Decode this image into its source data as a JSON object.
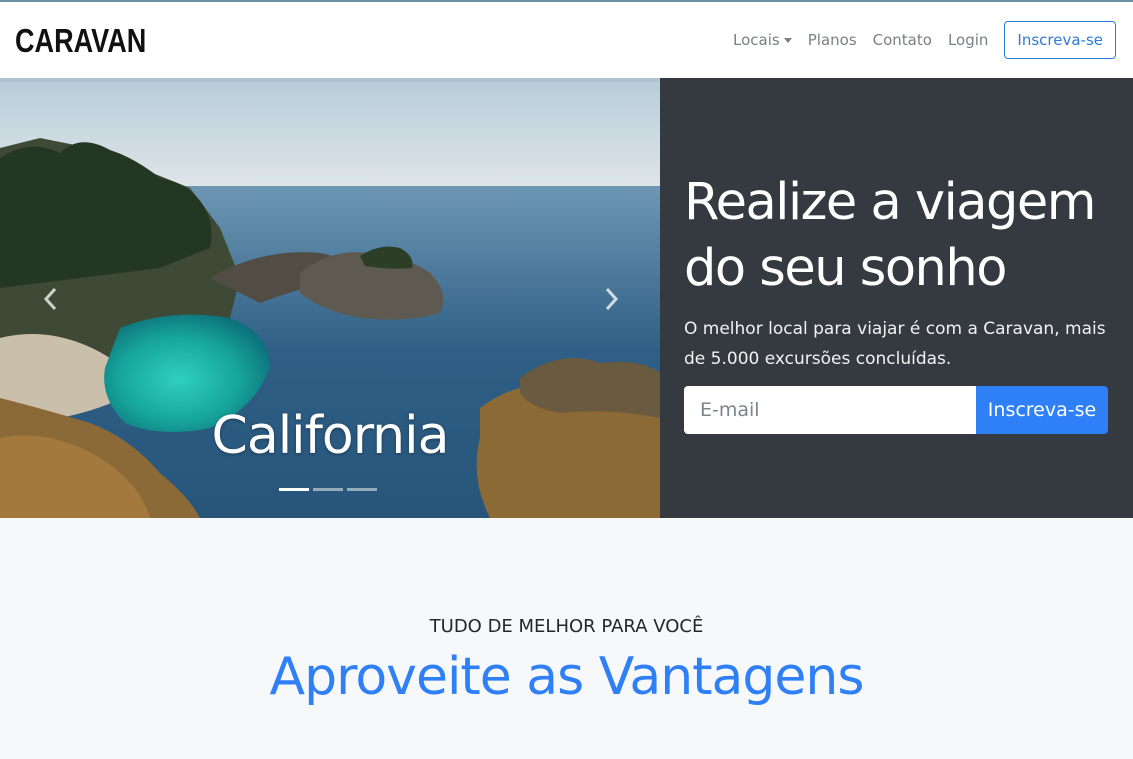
{
  "navbar": {
    "brand": "CARAVAN",
    "links": [
      {
        "label": "Locais",
        "dropdown": true
      },
      {
        "label": "Planos"
      },
      {
        "label": "Contato"
      },
      {
        "label": "Login"
      }
    ],
    "cta_label": "Inscreva-se"
  },
  "carousel": {
    "caption": "California",
    "slide_count": 3,
    "active_slide": 1,
    "prev_icon": "chevron-left-icon",
    "next_icon": "chevron-right-icon"
  },
  "hero": {
    "title_line1": "Realize a viagem",
    "title_line2": "do seu sonho",
    "subtitle": "O melhor local para viajar é com a Caravan, mais de 5.000 excursões concluídas.",
    "email_placeholder": "E-mail",
    "signup_label": "Inscreva-se"
  },
  "features": {
    "eyebrow": "TUDO DE MELHOR PARA VOCÊ",
    "title": "Aproveite as Vantagens"
  },
  "colors": {
    "primary": "#2f80f7",
    "dark_panel": "#343a40",
    "page_bg": "#f7f8fa"
  }
}
